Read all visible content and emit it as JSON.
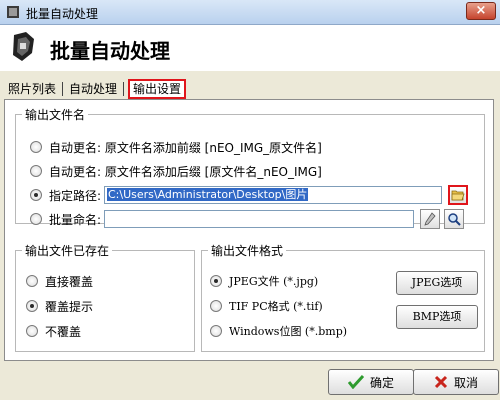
{
  "window": {
    "title": "批量自动处理",
    "close_label": "×"
  },
  "header": {
    "title": "批量自动处理"
  },
  "tabs": [
    {
      "label": "照片列表",
      "active": false
    },
    {
      "label": "自动处理",
      "active": false
    },
    {
      "label": "输出设置",
      "active": true
    }
  ],
  "output_filename": {
    "legend": "输出文件名",
    "options": [
      {
        "label": "自动更名: 原文件名添加前缀 [nEO_IMG_原文件名]",
        "checked": false
      },
      {
        "label": "自动更名: 原文件名添加后缀 [原文件名_nEO_IMG]",
        "checked": false
      },
      {
        "label": "指定路径:",
        "checked": true
      },
      {
        "label": "批量命名:",
        "checked": false
      }
    ],
    "path_value": "C:\\Users\\Administrator\\Desktop\\图片",
    "batch_name_value": ""
  },
  "file_exists": {
    "legend": "输出文件已存在",
    "options": [
      {
        "label": "直接覆盖",
        "checked": false
      },
      {
        "label": "覆盖提示",
        "checked": true
      },
      {
        "label": "不覆盖",
        "checked": false
      }
    ]
  },
  "output_format": {
    "legend": "输出文件格式",
    "options": [
      {
        "label": "JPEG文件 (*.jpg)",
        "checked": true
      },
      {
        "label": "TIF PC格式 (*.tif)",
        "checked": false
      },
      {
        "label": "Windows位图 (*.bmp)",
        "checked": false
      }
    ],
    "jpeg_options_label": "JPEG选项",
    "bmp_options_label": "BMP选项"
  },
  "footer": {
    "ok_label": "确定",
    "cancel_label": "取消"
  },
  "colors": {
    "highlight_red": "#e0151b",
    "selection_blue": "#3169c6",
    "ok_green": "#2e9b2e",
    "cancel_red": "#c8251c"
  }
}
